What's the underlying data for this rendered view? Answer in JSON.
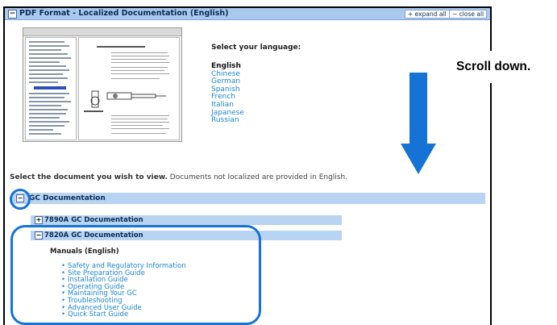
{
  "panel": {
    "toggle_symbol": "−",
    "title": "PDF Format - Localized Documentation (English)",
    "expand_all": "+ expand all",
    "close_all": "− close all"
  },
  "language_selector": {
    "heading": "Select your language:",
    "current": "English",
    "languages": [
      "Chinese",
      "German",
      "Spanish",
      "French",
      "Italian",
      "Japanese",
      "Russian"
    ]
  },
  "instruction": {
    "bold": "Select the document you wish to view.",
    "rest": " Documents not localized are provided in English."
  },
  "gc_section": {
    "toggle_symbol": "−",
    "title": "GC Documentation",
    "subsections": [
      {
        "toggle_symbol": "+",
        "title": "7890A GC Documentation"
      },
      {
        "toggle_symbol": "−",
        "title": "7820A GC Documentation"
      }
    ],
    "manuals_heading": "Manuals (English)",
    "manuals": [
      "Safety and Regulatory Information",
      "Site Preparation Guide",
      "Installation Guide",
      "Operating Guide",
      "Maintaining Your GC",
      "Troubleshooting",
      "Advanced User Guide",
      "Quick Start Guide"
    ]
  },
  "annotation": {
    "callout": "Scroll down.",
    "color": "#1573d6"
  }
}
